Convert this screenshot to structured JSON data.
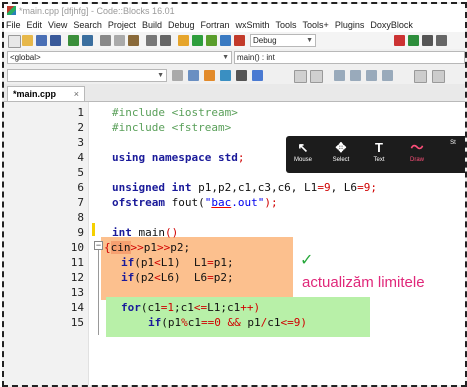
{
  "window": {
    "title": "*main.cpp [dfjhfg] - Code::Blocks 16.01"
  },
  "menu": [
    "File",
    "Edit",
    "View",
    "Search",
    "Project",
    "Build",
    "Debug",
    "Fortran",
    "wxSmith",
    "Tools",
    "Tools+",
    "Plugins",
    "DoxyBlock"
  ],
  "toolbar": {
    "build_target": "Debug"
  },
  "scope": {
    "scope_value": "<global>",
    "function_value": "main() : int"
  },
  "tab": {
    "label": "*main.cpp",
    "close": "×"
  },
  "line_numbers": [
    "1",
    "2",
    "3",
    "4",
    "5",
    "6",
    "7",
    "8",
    "9",
    "10",
    "11",
    "12",
    "13",
    "14",
    "15"
  ],
  "code": {
    "l1": {
      "a": "#include ",
      "b": "<iostream>"
    },
    "l2": {
      "a": "#include ",
      "b": "<fstream>"
    },
    "l4": {
      "a": "using namespace ",
      "b": "std",
      "c": ";"
    },
    "l6": {
      "kw": "unsigned int ",
      "a": "p1,p2,c1,c3,c6, L1",
      "eq1": "=",
      "n1": "9",
      "b": ", L6",
      "eq2": "=",
      "n2": "9",
      "c": ";"
    },
    "l7": {
      "a": "ofstream ",
      "b": "fout(",
      "s1": "\"",
      "s2": "bac",
      "s3": ".out\"",
      "c": ");"
    },
    "l9": {
      "kw": "int ",
      "a": "main",
      "p": "()"
    },
    "l10": {
      "a": "{",
      "b": "cin",
      "c": ">>",
      "d": "p1",
      "e": ">>",
      "f": "p2;"
    },
    "l11": {
      "kw": "if",
      "a": "(p1",
      "lt": "<",
      "b": "L1)  L1",
      "eq": "=",
      "c": "p1;"
    },
    "l12": {
      "kw": "if",
      "a": "(p2",
      "lt": "<",
      "b": "L6)  L6",
      "eq": "=",
      "c": "p2;"
    },
    "l14": {
      "kw": "for",
      "a": "(c1",
      "eq": "=",
      "n": "1",
      "b": ";c1",
      "le": "<=",
      "c": "L1;c1",
      "pp": "++",
      "d": ")"
    },
    "l15": {
      "kw": "if",
      "a": "(p1",
      "pct": "%",
      "b": "c1",
      "eq": "==",
      "n": "0",
      "and": " && ",
      "c": "p1",
      "div": "/",
      "d": "c1",
      "le": "<=",
      "n2": "9",
      "e": ")"
    }
  },
  "annotation": {
    "text": "actualizăm limitele",
    "check": "✓"
  },
  "draw_toolbar": [
    {
      "glyph": "↖",
      "label": "Mouse",
      "icon": "cursor-icon"
    },
    {
      "glyph": "✥",
      "label": "Select",
      "icon": "move-icon"
    },
    {
      "glyph": "T",
      "label": "Text",
      "icon": "text-icon"
    },
    {
      "glyph": "〜",
      "label": "Draw",
      "icon": "pen-icon"
    },
    {
      "glyph": "",
      "label": "St",
      "icon": "stamp-icon"
    }
  ],
  "colors": {
    "keyword": "#1a1a9a",
    "preprocessor": "#5aa05a",
    "string": "#0000ee",
    "operator": "#d00000",
    "highlight_orange": "#fcc08e",
    "highlight_green": "#b8f0a8",
    "annotation": "#e0287a",
    "draw_active": "#ff4f7a"
  }
}
